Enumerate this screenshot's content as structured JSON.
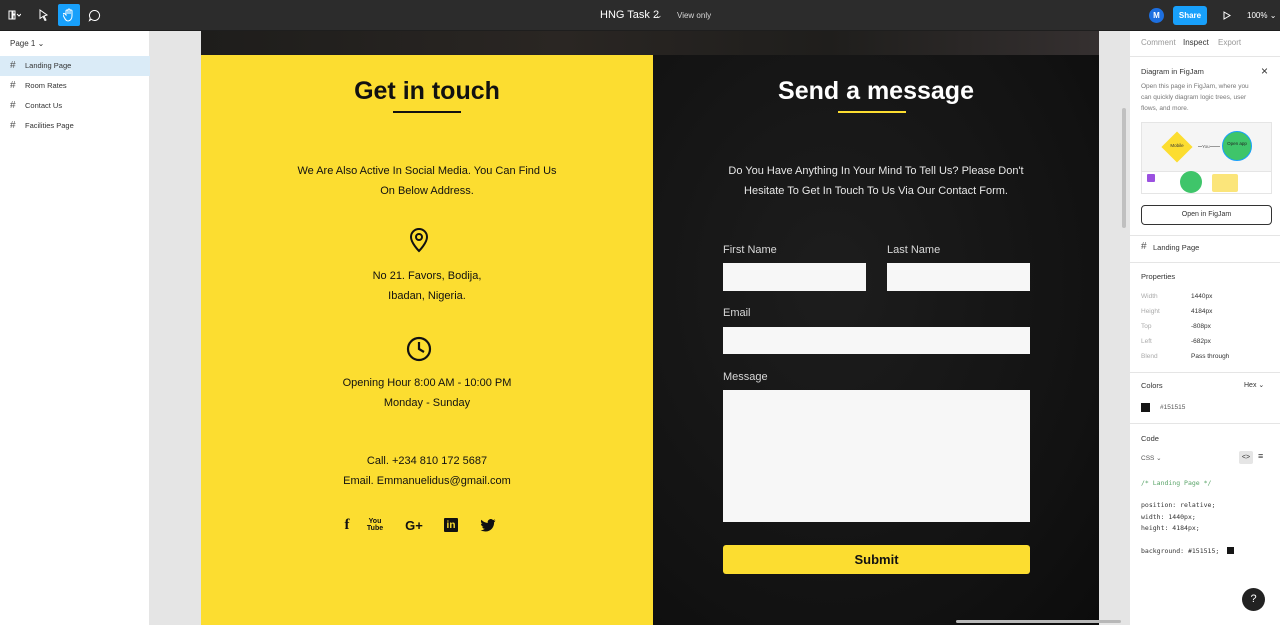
{
  "toolbar": {
    "file_title": "HNG Task 2",
    "view_mode": "View only",
    "avatar_initial": "M",
    "share_label": "Share",
    "zoom": "100%"
  },
  "left_panel": {
    "page_selector": "Page 1",
    "layers": [
      {
        "label": "Landing Page"
      },
      {
        "label": "Room Rates"
      },
      {
        "label": "Contact Us"
      },
      {
        "label": "Facilities Page"
      }
    ]
  },
  "contact": {
    "title": "Get in touch",
    "intro_line1": "We Are Also Active In Social Media. You Can Find Us",
    "intro_line2": "On Below Address.",
    "address_line1": "No 21. Favors, Bodija,",
    "address_line2": "Ibadan, Nigeria.",
    "hours_line1": "Opening Hour 8:00 AM - 10:00 PM",
    "hours_line2": "Monday - Sunday",
    "phone": "Call. +234 810 172 5687",
    "email": "Email. Emmanuelidus@gmail.com",
    "social_youtube_text": "You Tube",
    "social_googleplus_text": "G+",
    "social_linkedin_text": "in",
    "social_facebook_text": "f"
  },
  "message": {
    "title": "Send a message",
    "intro_line1": "Do You Have Anything In Your Mind To Tell Us? Please Don't",
    "intro_line2": "Hesitate To Get In Touch To Us Via Our Contact Form.",
    "first_name_label": "First Name",
    "last_name_label": "Last Name",
    "email_label": "Email",
    "message_label": "Message",
    "submit_label": "Submit"
  },
  "right_panel": {
    "tabs": [
      "Comment",
      "Inspect",
      "Export"
    ],
    "figjam_title": "Diagram in FigJam",
    "figjam_desc_1": "Open this page in FigJam, where you",
    "figjam_desc_2": "can quickly diagram logic trees, user",
    "figjam_desc_3": "flows, and more.",
    "figjam_preview_mobile": "Mobile",
    "figjam_preview_you": "You",
    "figjam_preview_open": "Open app",
    "figjam_button": "Open in FigJam",
    "selected_layer": "Landing Page",
    "properties_title": "Properties",
    "properties": [
      {
        "key": "Width",
        "value": "1440px"
      },
      {
        "key": "Height",
        "value": "4184px"
      },
      {
        "key": "Top",
        "value": "-808px"
      },
      {
        "key": "Left",
        "value": "-682px"
      },
      {
        "key": "Blend",
        "value": "Pass through"
      }
    ],
    "colors_title": "Colors",
    "color_format": "Hex",
    "color_value": "#151515",
    "color_swatch": "#151515",
    "code_title": "Code",
    "code_lang": "CSS",
    "code_lines": [
      "/* Landing Page */",
      "position: relative;",
      "width: 1440px;",
      "height: 4184px;",
      "background: #151515;"
    ]
  },
  "help_label": "?"
}
